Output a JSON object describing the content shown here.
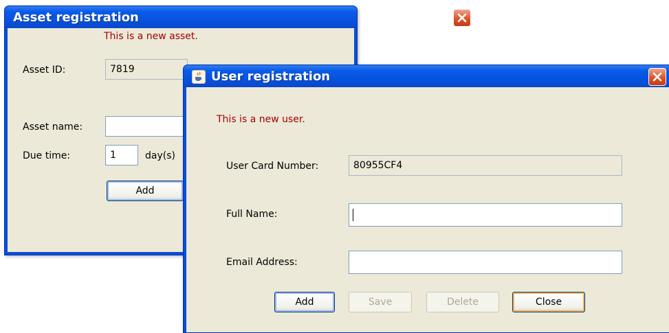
{
  "asset_window": {
    "title": "Asset registration",
    "message": "This is a new asset.",
    "asset_id_label": "Asset ID:",
    "asset_id_value": "7819",
    "asset_name_label": "Asset name:",
    "asset_name_value": "",
    "due_time_label": "Due time:",
    "due_time_value": "1",
    "due_time_unit": "day(s)",
    "add_button": "Add"
  },
  "user_window": {
    "title": "User registration",
    "message": "This is a new user.",
    "card_number_label": "User Card Number:",
    "card_number_value": "80955CF4",
    "full_name_label": "Full Name:",
    "full_name_value": "",
    "email_label": "Email Address:",
    "email_value": "",
    "buttons": {
      "add": "Add",
      "save": "Save",
      "delete": "Delete",
      "close": "Close"
    }
  },
  "colors": {
    "titlebar": "#0a5be6",
    "message_red": "#a40000",
    "client_bg": "#ece9d8",
    "close_button": "#d8562c"
  },
  "icons": {
    "title_icon": "java-cup-icon",
    "close": "close-icon"
  }
}
